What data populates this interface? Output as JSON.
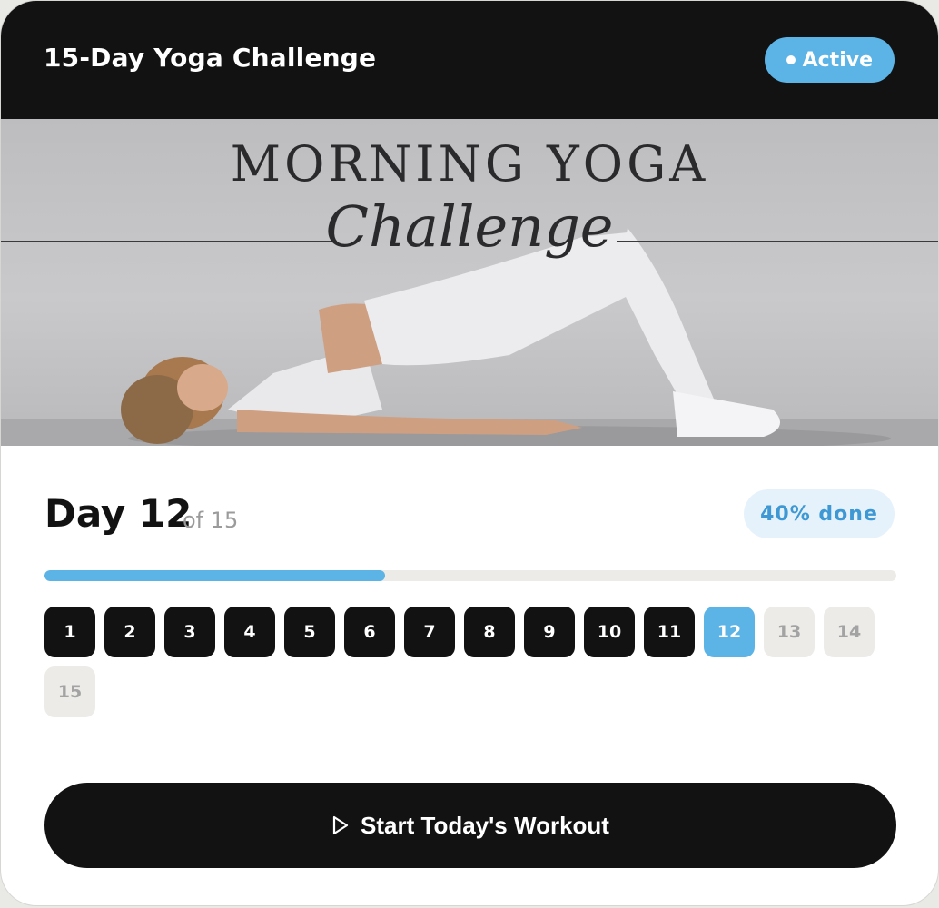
{
  "header": {
    "title": "15-Day Yoga Challenge",
    "status_label": "Active"
  },
  "banner": {
    "title": "MORNING YOGA",
    "subtitle": "Challenge"
  },
  "progress": {
    "day_label": "Day 12",
    "of_label": "of 15",
    "percent_label": "40% done",
    "fraction": 0.4
  },
  "days": [
    {
      "label": "1",
      "state": "done"
    },
    {
      "label": "2",
      "state": "done"
    },
    {
      "label": "3",
      "state": "done"
    },
    {
      "label": "4",
      "state": "done"
    },
    {
      "label": "5",
      "state": "done"
    },
    {
      "label": "6",
      "state": "done"
    },
    {
      "label": "7",
      "state": "done"
    },
    {
      "label": "8",
      "state": "done"
    },
    {
      "label": "9",
      "state": "done"
    },
    {
      "label": "10",
      "state": "done"
    },
    {
      "label": "11",
      "state": "done"
    },
    {
      "label": "12",
      "state": "current"
    },
    {
      "label": "13",
      "state": "upcoming"
    },
    {
      "label": "14",
      "state": "upcoming"
    },
    {
      "label": "15",
      "state": "upcoming"
    }
  ],
  "cta": {
    "label": "Start Today's Workout",
    "icon": "play-icon"
  },
  "colors": {
    "accent": "#5cb3e6",
    "dark": "#121212",
    "upcoming": "#ecebe8"
  }
}
